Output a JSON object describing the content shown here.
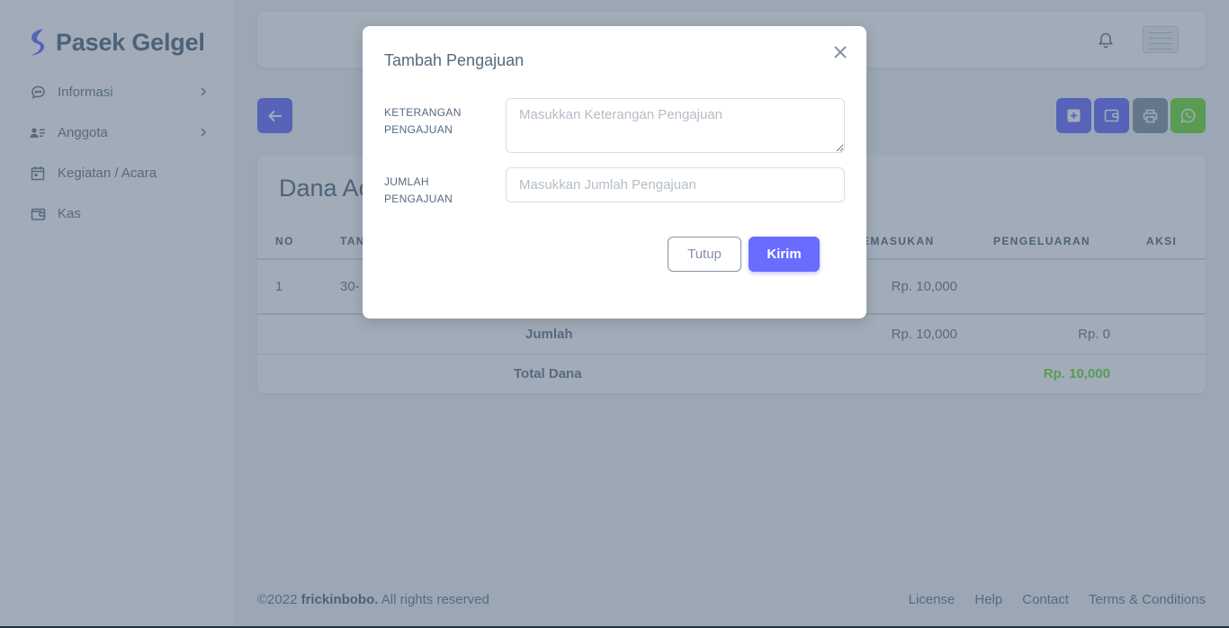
{
  "brand": {
    "name": "Pasek Gelgel",
    "logo_icon": "s-logo-icon"
  },
  "sidebar": {
    "items": [
      {
        "label": "Informasi",
        "icon": "chat-icon",
        "has_submenu": true
      },
      {
        "label": "Anggota",
        "icon": "user-list-icon",
        "has_submenu": true
      },
      {
        "label": "Kegiatan / Acara",
        "icon": "calendar-icon",
        "has_submenu": false
      },
      {
        "label": "Kas",
        "icon": "wallet-icon",
        "has_submenu": false
      }
    ]
  },
  "topbar": {
    "notification_icon": "bell-icon",
    "avatar": "user-avatar"
  },
  "toolbar": {
    "back_icon": "arrow-left-icon",
    "actions": [
      {
        "icon": "plus-square-icon",
        "color": "#696cff"
      },
      {
        "icon": "wallet-icon",
        "color": "#696cff"
      },
      {
        "icon": "printer-icon",
        "color": "#8592a3"
      },
      {
        "icon": "whatsapp-icon",
        "color": "#71dd37"
      }
    ]
  },
  "card": {
    "title": "Dana Ac",
    "table": {
      "headers": [
        "NO",
        "TAN",
        "EMASUKAN",
        "PENGELUARAN",
        "AKSI"
      ],
      "rows": [
        {
          "no": "1",
          "tanggal": "30-",
          "pemasukan": "Rp. 10,000",
          "pengeluaran": ""
        }
      ],
      "jumlah": {
        "label": "Jumlah",
        "pemasukan": "Rp. 10,000",
        "pengeluaran": "Rp. 0"
      },
      "total": {
        "label": "Total Dana",
        "value": "Rp. 10,000",
        "value_color": "#71dd37"
      }
    }
  },
  "footer": {
    "year": "©2022",
    "author": "frickinbobo.",
    "rights": "All rights reserved",
    "links": [
      "License",
      "Help",
      "Contact",
      "Terms & Conditions"
    ]
  },
  "modal": {
    "title": "Tambah Pengajuan",
    "close_icon": "close-icon",
    "fields": {
      "keterangan": {
        "label_line1": "KETERANGAN",
        "label_line2": "PENGAJUAN",
        "placeholder": "Masukkan Keterangan Pengajuan",
        "value": ""
      },
      "jumlah": {
        "label_line1": "JUMLAH",
        "label_line2": "PENGAJUAN",
        "placeholder": "Masukkan Jumlah Pengajuan",
        "value": ""
      }
    },
    "buttons": {
      "cancel": "Tutup",
      "submit": "Kirim"
    }
  }
}
